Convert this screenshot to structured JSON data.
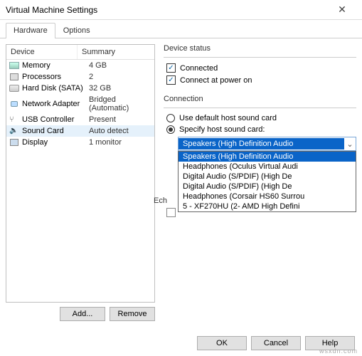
{
  "window": {
    "title": "Virtual Machine Settings",
    "close": "✕"
  },
  "tabs": {
    "hardware": "Hardware",
    "options": "Options"
  },
  "device_table": {
    "col_device": "Device",
    "col_summary": "Summary",
    "rows": [
      {
        "name": "Memory",
        "summary": "4 GB"
      },
      {
        "name": "Processors",
        "summary": "2"
      },
      {
        "name": "Hard Disk (SATA)",
        "summary": "32 GB"
      },
      {
        "name": "Network Adapter",
        "summary": "Bridged (Automatic)"
      },
      {
        "name": "USB Controller",
        "summary": "Present"
      },
      {
        "name": "Sound Card",
        "summary": "Auto detect"
      },
      {
        "name": "Display",
        "summary": "1 monitor"
      }
    ]
  },
  "left_buttons": {
    "add": "Add...",
    "remove": "Remove"
  },
  "device_status": {
    "title": "Device status",
    "connected": "Connected",
    "connect_at_power_on": "Connect at power on"
  },
  "connection": {
    "title": "Connection",
    "use_default": "Use default host sound card",
    "specify": "Specify host sound card:",
    "selected": "Speakers (High Definition Audio",
    "options": [
      "Speakers (High Definition Audio",
      "Headphones (Oculus Virtual Audi",
      "Digital Audio (S/PDIF) (High De",
      "Digital Audio (S/PDIF) (High De",
      "Headphones (Corsair HS60 Surrou",
      "5 - XF270HU (2- AMD High Defini"
    ],
    "echo_label": "Ech"
  },
  "footer": {
    "ok": "OK",
    "cancel": "Cancel",
    "help": "Help"
  },
  "watermark": "wsxdn.com"
}
